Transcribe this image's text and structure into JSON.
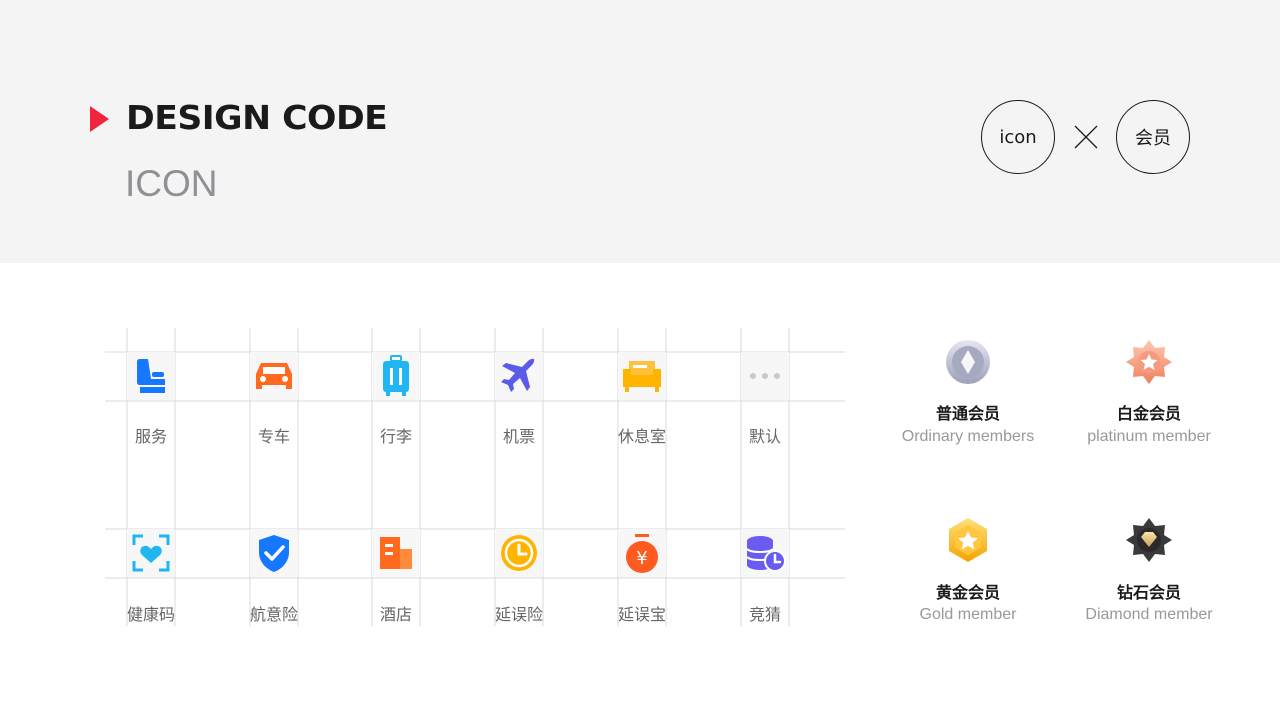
{
  "header": {
    "title": "DESIGN CODE",
    "subtitle": "ICON",
    "circle_left": "icon",
    "circle_right": "会员",
    "accent_color": "#f0243d"
  },
  "icons": [
    {
      "label": "服务",
      "icon": "seat-icon",
      "color": "#1677ff"
    },
    {
      "label": "专车",
      "icon": "car-icon",
      "color": "#ff6a1f"
    },
    {
      "label": "行李",
      "icon": "luggage-icon",
      "color": "#1fb6f2"
    },
    {
      "label": "机票",
      "icon": "airplane-icon",
      "color": "#5b5bea"
    },
    {
      "label": "休息室",
      "icon": "sofa-icon",
      "color": "#ffb400"
    },
    {
      "label": "默认",
      "icon": "more-dots-icon",
      "color": "#c8c8cc"
    },
    {
      "label": "健康码",
      "icon": "health-scan-icon",
      "color": "#1fb6f2"
    },
    {
      "label": "航意险",
      "icon": "shield-check-icon",
      "color": "#1677ff"
    },
    {
      "label": "酒店",
      "icon": "hotel-icon",
      "color": "#ff6a1f"
    },
    {
      "label": "延误险",
      "icon": "clock-icon",
      "color": "#ffb400"
    },
    {
      "label": "延误宝",
      "icon": "money-bag-icon",
      "color": "#ff5a1f"
    },
    {
      "label": "竞猜",
      "icon": "coins-clock-icon",
      "color": "#6a5cf0"
    }
  ],
  "members": [
    {
      "cn": "普通会员",
      "en": "Ordinary members",
      "icon": "silver-diamond-badge-icon"
    },
    {
      "cn": "白金会员",
      "en": "platinum member",
      "icon": "platinum-star-badge-icon"
    },
    {
      "cn": "黄金会员",
      "en": "Gold member",
      "icon": "gold-star-badge-icon"
    },
    {
      "cn": "钻石会员",
      "en": "Diamond member",
      "icon": "diamond-badge-icon"
    }
  ]
}
